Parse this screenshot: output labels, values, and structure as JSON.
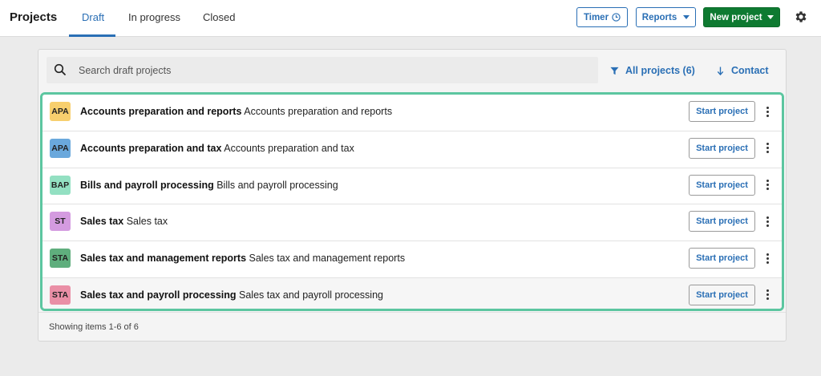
{
  "header": {
    "title": "Projects",
    "tabs": [
      {
        "label": "Draft",
        "active": true
      },
      {
        "label": "In progress",
        "active": false
      },
      {
        "label": "Closed",
        "active": false
      }
    ],
    "timer_label": "Timer",
    "reports_label": "Reports",
    "new_project_label": "New project"
  },
  "toolbar": {
    "search_placeholder": "Search draft projects",
    "filter_label": "All projects (6)",
    "sort_label": "Contact"
  },
  "projects": [
    {
      "badge": "APA",
      "badge_color": "#f7cf6e",
      "name": "Accounts preparation and reports",
      "description": "Accounts preparation and reports",
      "action": "Start project"
    },
    {
      "badge": "APA",
      "badge_color": "#6aa8dc",
      "name": "Accounts preparation and tax",
      "description": "Accounts preparation and tax",
      "action": "Start project"
    },
    {
      "badge": "BAP",
      "badge_color": "#93e0c2",
      "name": "Bills and payroll processing",
      "description": "Bills and payroll processing",
      "action": "Start project"
    },
    {
      "badge": "ST",
      "badge_color": "#d49be0",
      "name": "Sales tax",
      "description": "Sales tax",
      "action": "Start project"
    },
    {
      "badge": "STA",
      "badge_color": "#5fae7d",
      "name": "Sales tax and management reports",
      "description": "Sales tax and management reports",
      "action": "Start project"
    },
    {
      "badge": "STA",
      "badge_color": "#ea8fa6",
      "name": "Sales tax and payroll processing",
      "description": "Sales tax and payroll processing",
      "action": "Start project"
    }
  ],
  "footer": {
    "pagination_text": "Showing items 1-6 of 6"
  },
  "colors": {
    "accent": "#2a6fb5",
    "primary_button": "#0e7a31",
    "highlight_border": "#5cc6a0"
  }
}
